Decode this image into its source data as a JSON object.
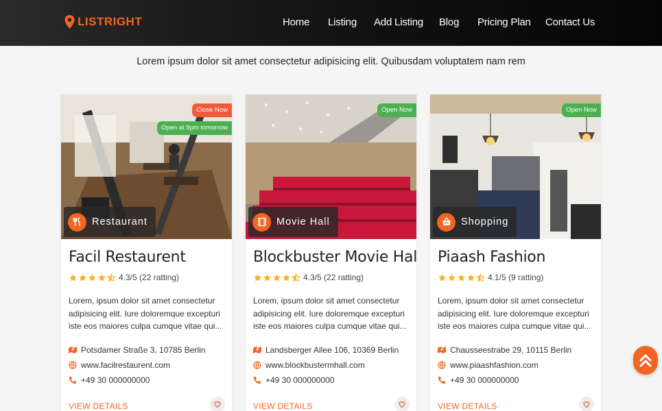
{
  "brand": {
    "name": "LISTRIGHT",
    "accent": "#f26522"
  },
  "nav": [
    {
      "label": "Home"
    },
    {
      "label": "Listing"
    },
    {
      "label": "Add Listing"
    },
    {
      "label": "Blog"
    },
    {
      "label": "Pricing Plan"
    },
    {
      "label": "Contact Us"
    }
  ],
  "tagline": "Lorem ipsum dolor sit amet consectetur adipisicing elit. Quibusdam voluptatem nam rem",
  "cards": [
    {
      "category": "Restaurant",
      "category_icon": "fork-knife-icon",
      "badges": [
        "Close Now",
        "Open at 9pm tomorrow"
      ],
      "title": "Facil Restaurent",
      "rating": 4.3,
      "rating_text": "4.3/5 (22 ratting)",
      "description": "Lorem, ipsum dolor sit amet consectetur adipisicing elit. Iure doloremque excepturi iste eos maiores culpa cumque vitae qui...",
      "address": "Potsdamer Straße 3, 10785 Berlin",
      "website": "www.facilrestaurent.com",
      "phone": "+49 30 000000000",
      "cta": "VIEW DETAILS"
    },
    {
      "category": "Movie Hall",
      "category_icon": "film-icon",
      "badges": [
        "Open Now"
      ],
      "title": "Blockbuster Movie Hall",
      "rating": 4.3,
      "rating_text": "4.3/5 (22 ratting)",
      "description": "Lorem, ipsum dolor sit amet consectetur adipisicing elit. Iure doloremque excepturi iste eos maiores culpa cumque vitae qui...",
      "address": "Landsberger Allee 106, 10369 Berlin",
      "website": "www.blockbustermhall.com",
      "phone": "+49 30 000000000",
      "cta": "VIEW DETAILS"
    },
    {
      "category": "Shopping",
      "category_icon": "shopping-basket-icon",
      "badges": [
        "Open Now"
      ],
      "title": "Piaash Fashion",
      "rating": 4.1,
      "rating_text": "4.1/5 (9 ratting)",
      "description": "Lorem, ipsum dolor sit amet consectetur adipisicing elit. Iure doloremque excepturi iste eos maiores culpa cumque vitae qui...",
      "address": "Chausseestrabe 29, 10115 Berlin",
      "website": "www.piaashfashion.com",
      "phone": "+49 30 000000000",
      "cta": "VIEW DETAILS"
    }
  ],
  "colors": {
    "badge_closed": "#f05a3c",
    "badge_open": "#4caf50",
    "star": "#f6b324"
  }
}
